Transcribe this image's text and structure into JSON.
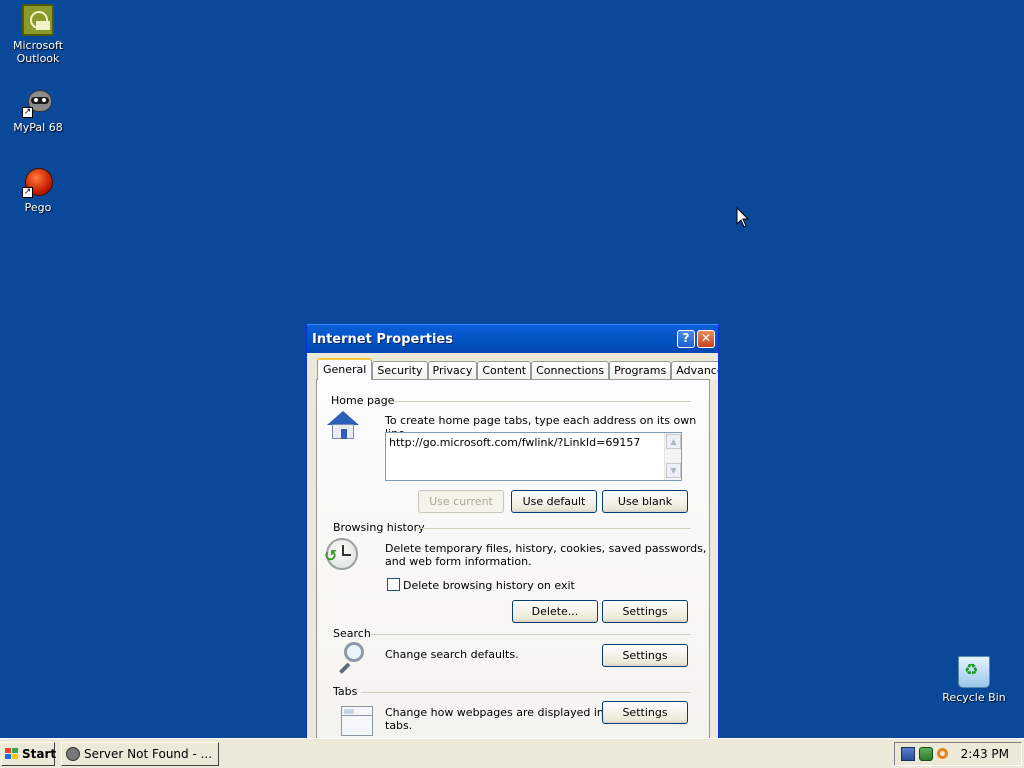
{
  "desktop": {
    "icons": [
      {
        "label_line1": "Microsoft",
        "label_line2": "Outlook"
      },
      {
        "label_line1": "MyPal 68",
        "label_line2": ""
      },
      {
        "label_line1": "Pego",
        "label_line2": ""
      },
      {
        "label_line1": "Recycle Bin",
        "label_line2": ""
      }
    ]
  },
  "dialog": {
    "title": "Internet Properties",
    "help_glyph": "?",
    "close_glyph": "✕",
    "tabs": [
      "General",
      "Security",
      "Privacy",
      "Content",
      "Connections",
      "Programs",
      "Advanced"
    ],
    "active_tab": "General",
    "home_page": {
      "heading": "Home page",
      "instruction": "To create home page tabs, type each address on its own line.",
      "url_value": "http://go.microsoft.com/fwlink/?LinkId=69157",
      "use_current": "Use current",
      "use_default": "Use default",
      "use_blank": "Use blank"
    },
    "browsing_history": {
      "heading": "Browsing history",
      "description_line1": "Delete temporary files, history, cookies, saved passwords,",
      "description_line2": "and web form information.",
      "checkbox_label": "Delete browsing history on exit",
      "checkbox_checked": false,
      "delete_button": "Delete...",
      "settings_button": "Settings"
    },
    "search": {
      "heading": "Search",
      "description": "Change search defaults.",
      "settings_button": "Settings"
    },
    "tabs_section": {
      "heading": "Tabs",
      "description_line1": "Change how webpages are displayed in",
      "description_line2": "tabs.",
      "settings_button": "Settings"
    }
  },
  "taskbar": {
    "start_label": "Start",
    "task_button": "Server Not Found - ...",
    "clock": "2:43 PM",
    "tray_icons": [
      "network-icon",
      "sync-icon",
      "search-icon"
    ]
  }
}
